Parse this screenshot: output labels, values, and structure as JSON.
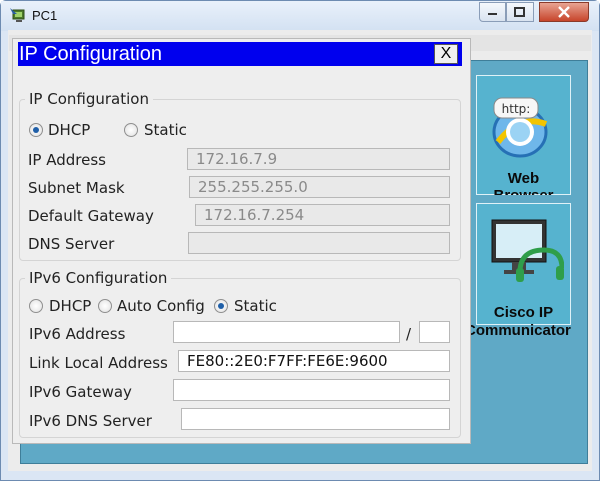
{
  "window": {
    "title": "PC1",
    "icon": "pc-icon"
  },
  "dialog": {
    "title": "IP Configuration",
    "close_label": "X"
  },
  "ipv4": {
    "group_label": "IP Configuration",
    "mode_options": [
      "DHCP",
      "Static"
    ],
    "selected_mode": "DHCP",
    "fields": {
      "ip_address": {
        "label": "IP Address",
        "value": "172.16.7.9"
      },
      "subnet_mask": {
        "label": "Subnet Mask",
        "value": "255.255.255.0"
      },
      "default_gateway": {
        "label": "Default Gateway",
        "value": "172.16.7.254"
      },
      "dns_server": {
        "label": "DNS Server",
        "value": ""
      }
    }
  },
  "ipv6": {
    "group_label": "IPv6 Configuration",
    "mode_options": [
      "DHCP",
      "Auto Config",
      "Static"
    ],
    "selected_mode": "Static",
    "fields": {
      "address": {
        "label": "IPv6 Address",
        "value": "",
        "prefix_separator": "/",
        "prefix": ""
      },
      "link_local": {
        "label": "Link Local Address",
        "value": "FE80::2E0:F7FF:FE6E:9600"
      },
      "gateway": {
        "label": "IPv6 Gateway",
        "value": ""
      },
      "dns_server": {
        "label": "IPv6 DNS Server",
        "value": ""
      }
    }
  },
  "desktop_apps": [
    {
      "label": "Web Browser",
      "label_line1": "Web",
      "label_line2": "Browser",
      "icon": "web-browser-icon",
      "icon_text": "http:"
    },
    {
      "label": "Cisco IP Communicator",
      "label_line1": "Cisco IP",
      "label_line2": "Communicator",
      "icon": "ip-communicator-icon"
    }
  ],
  "colors": {
    "title_bar": "#0000ee",
    "desktop": "#5fa9c6",
    "tile": "#56b3cf",
    "close_button": "#c7452b"
  }
}
